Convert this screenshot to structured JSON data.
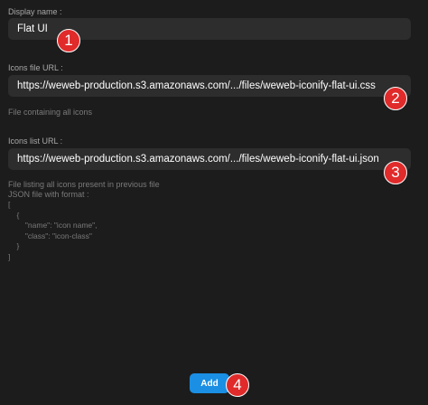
{
  "form": {
    "display_name": {
      "label": "Display name :",
      "value": "Flat UI"
    },
    "icons_file_url": {
      "label": "Icons file URL :",
      "value": "https://weweb-production.s3.amazonaws.com/.../files/weweb-iconify-flat-ui.css",
      "helper": "File containing all icons"
    },
    "icons_list_url": {
      "label": "Icons list URL :",
      "value": "https://weweb-production.s3.amazonaws.com/.../files/weweb-iconify-flat-ui.json",
      "helper_lines": [
        "File listing all icons present in previous file",
        "JSON file with format :",
        "[",
        "    {",
        "        \"name\": \"icon name\",",
        "        \"class\": \"icon-class\"",
        "    }",
        "]"
      ]
    },
    "add_label": "Add"
  },
  "annotations": [
    "1",
    "2",
    "3",
    "4"
  ],
  "colors": {
    "background": "#1c1c1c",
    "input_bg": "#2d2d2d",
    "accent": "#1a8fe3",
    "badge": "#e12a2a"
  }
}
